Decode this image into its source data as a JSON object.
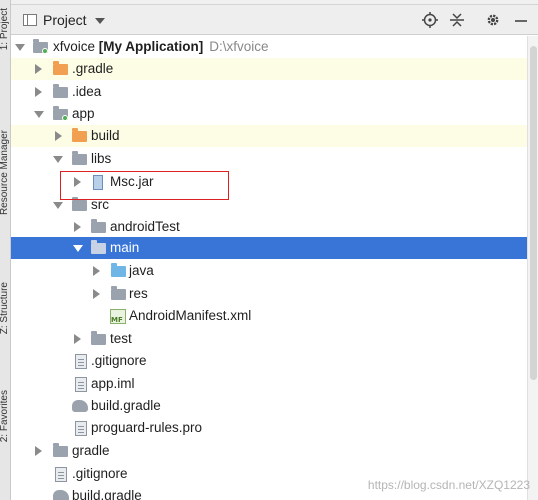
{
  "side_tabs": [
    "1: Project",
    "Resource Manager",
    "Z: Structure",
    "2: Favorites"
  ],
  "header": {
    "title": "Project"
  },
  "toolbar": {
    "icons": [
      "crosshair-icon",
      "collapse-all-icon",
      "gear-icon",
      "minimize-icon"
    ]
  },
  "tree": {
    "root_name": "xfvoice",
    "root_module": "[My Application]",
    "root_path": "D:\\xfvoice",
    "items": [
      ".gradle",
      ".idea",
      "app",
      "build",
      "libs",
      "Msc.jar",
      "src",
      "androidTest",
      "main",
      "java",
      "res",
      "AndroidManifest.xml",
      "test",
      ".gitignore",
      "app.iml",
      "build.gradle",
      "proguard-rules.pro",
      "gradle",
      ".gitignore",
      "build.gradle"
    ]
  },
  "watermark": "https://blog.csdn.net/XZQ1223",
  "colors": {
    "selection": "#3875d7",
    "highlight_box": "#e02020",
    "tint": "#fdfde6"
  }
}
